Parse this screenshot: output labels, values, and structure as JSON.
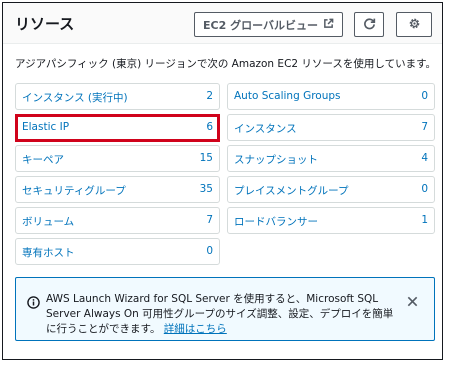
{
  "header": {
    "title": "リソース",
    "ec2_global_view_label": "EC2 グローバルビュー"
  },
  "description": "アジアパシフィック (東京) リージョンで次の Amazon EC2 リソースを使用しています。",
  "resources": [
    {
      "label": "インスタンス (実行中)",
      "count": "2"
    },
    {
      "label": "Auto Scaling Groups",
      "count": "0"
    },
    {
      "label": "Elastic IP",
      "count": "6"
    },
    {
      "label": "インスタンス",
      "count": "7"
    },
    {
      "label": "キーペア",
      "count": "15"
    },
    {
      "label": "スナップショット",
      "count": "4"
    },
    {
      "label": "セキュリティグループ",
      "count": "35"
    },
    {
      "label": "プレイスメントグループ",
      "count": "0"
    },
    {
      "label": "ボリューム",
      "count": "7"
    },
    {
      "label": "ロードバランサー",
      "count": "1"
    },
    {
      "label": "専有ホスト",
      "count": "0"
    }
  ],
  "flash": {
    "message": "AWS Launch Wizard for SQL Server を使用すると、Microsoft SQL Server Always On 可用性グループのサイズ調整、設定、デプロイを簡単に行うことができます。",
    "link_label": "詳細はこちら"
  },
  "colors": {
    "link": "#0073bb",
    "highlight": "#d0021b",
    "info_background": "#f1faff"
  }
}
